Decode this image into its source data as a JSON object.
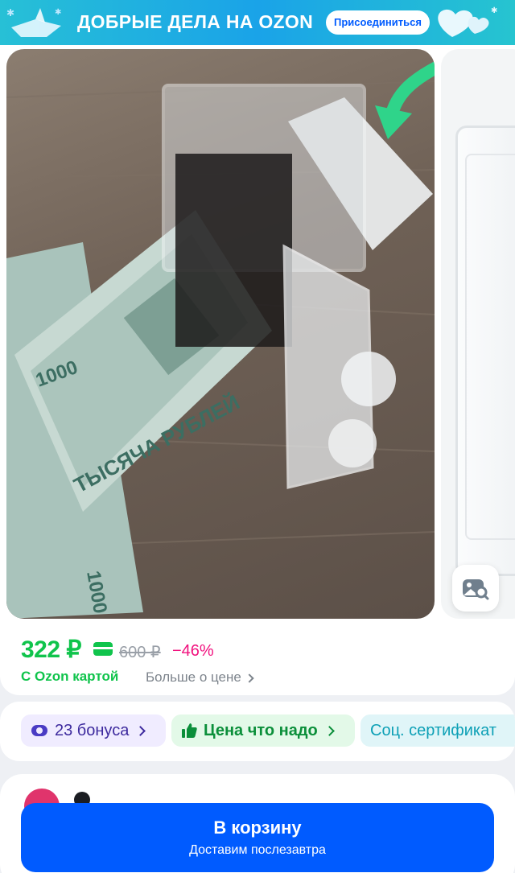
{
  "banner": {
    "title": "ДОБРЫЕ ДЕЛА НА OZON",
    "join_label": "Присоединиться"
  },
  "gallery": {
    "banknote_value": "1000",
    "banknote_text": "ТЫСЯЧА РУБЛЕЙ"
  },
  "price": {
    "current": "322 ₽",
    "old": "600 ₽",
    "discount": "−46%",
    "ozon_card_label": "С Ozon картой",
    "more_label": "Больше о цене"
  },
  "chips": [
    {
      "label": "23 бонуса"
    },
    {
      "label": "Цена что надо"
    },
    {
      "label": "Соц. сертификат"
    }
  ],
  "cart": {
    "title": "В корзину",
    "subtitle": "Доставим послезавтра"
  },
  "colors": {
    "accent": "#005bff",
    "price_green": "#10c44c",
    "discount_pink": "#f1117e",
    "banner": "#1aa3e8"
  }
}
